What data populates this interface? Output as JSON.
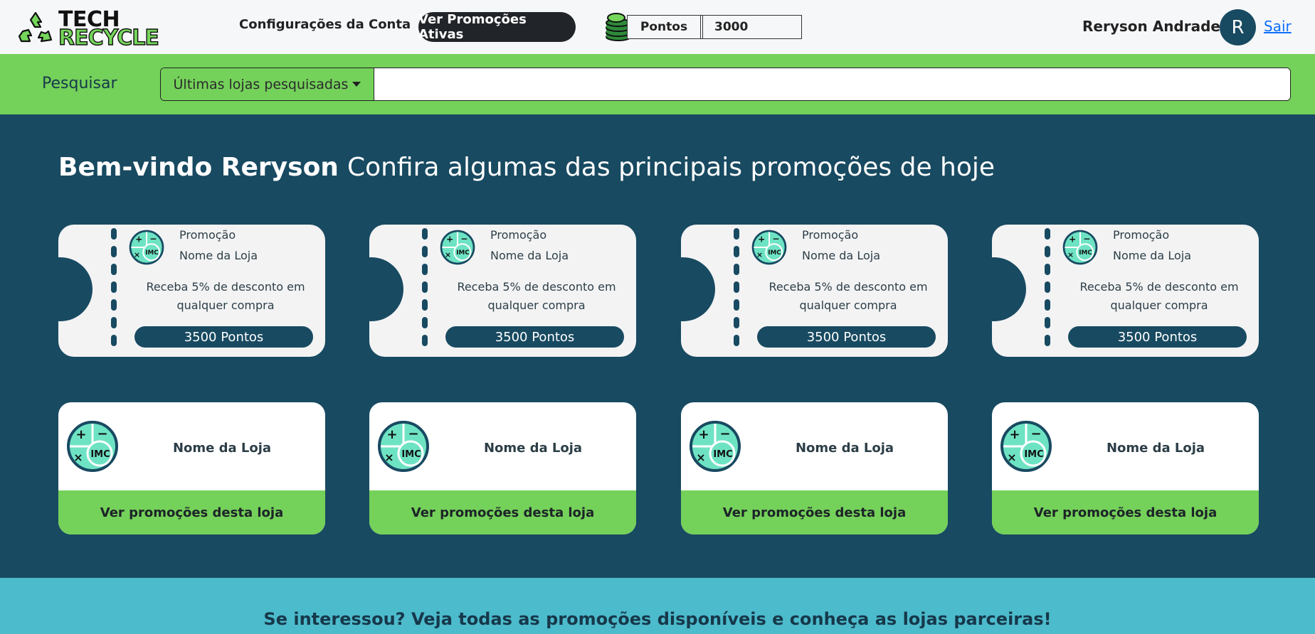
{
  "header": {
    "logo": {
      "line1": "TECH",
      "line2": "RECYCLE"
    },
    "nav": {
      "account_settings": "Configurações da Conta",
      "active_promos": "Ver Promoções Ativas"
    },
    "points": {
      "label": "Pontos",
      "value": "3000"
    },
    "user": {
      "name": "Reryson Andrade",
      "initial": "R",
      "logout": "Sair"
    }
  },
  "search": {
    "label": "Pesquisar",
    "dropdown": "Últimas lojas pesquisadas",
    "value": ""
  },
  "welcome": {
    "greeting": "Bem-vindo Reryson",
    "subtitle": "Confira algumas das principais promoções de hoje"
  },
  "coupons": [
    {
      "type": "Promoção",
      "store": "Nome da Loja",
      "description": "Receba 5% de desconto em qualquer compra",
      "points": "3500 Pontos"
    },
    {
      "type": "Promoção",
      "store": "Nome da Loja",
      "description": "Receba 5% de desconto em qualquer compra",
      "points": "3500 Pontos"
    },
    {
      "type": "Promoção",
      "store": "Nome da Loja",
      "description": "Receba 5% de desconto em qualquer compra",
      "points": "3500 Pontos"
    },
    {
      "type": "Promoção",
      "store": "Nome da Loja",
      "description": "Receba 5% de desconto em qualquer compra",
      "points": "3500 Pontos"
    }
  ],
  "stores": [
    {
      "name": "Nome da Loja",
      "button": "Ver promoções desta loja"
    },
    {
      "name": "Nome da Loja",
      "button": "Ver promoções desta loja"
    },
    {
      "name": "Nome da Loja",
      "button": "Ver promoções desta loja"
    },
    {
      "name": "Nome da Loja",
      "button": "Ver promoções desta loja"
    }
  ],
  "store_icon_text": "IMC",
  "cta": {
    "text": "Se interessou? Veja todas as promoções disponíveis e conheça as lojas parceiras!"
  },
  "colors": {
    "navy": "#184a61",
    "green": "#74d15a",
    "cyan": "#4cbbcc",
    "mint": "#6ee3c4"
  }
}
